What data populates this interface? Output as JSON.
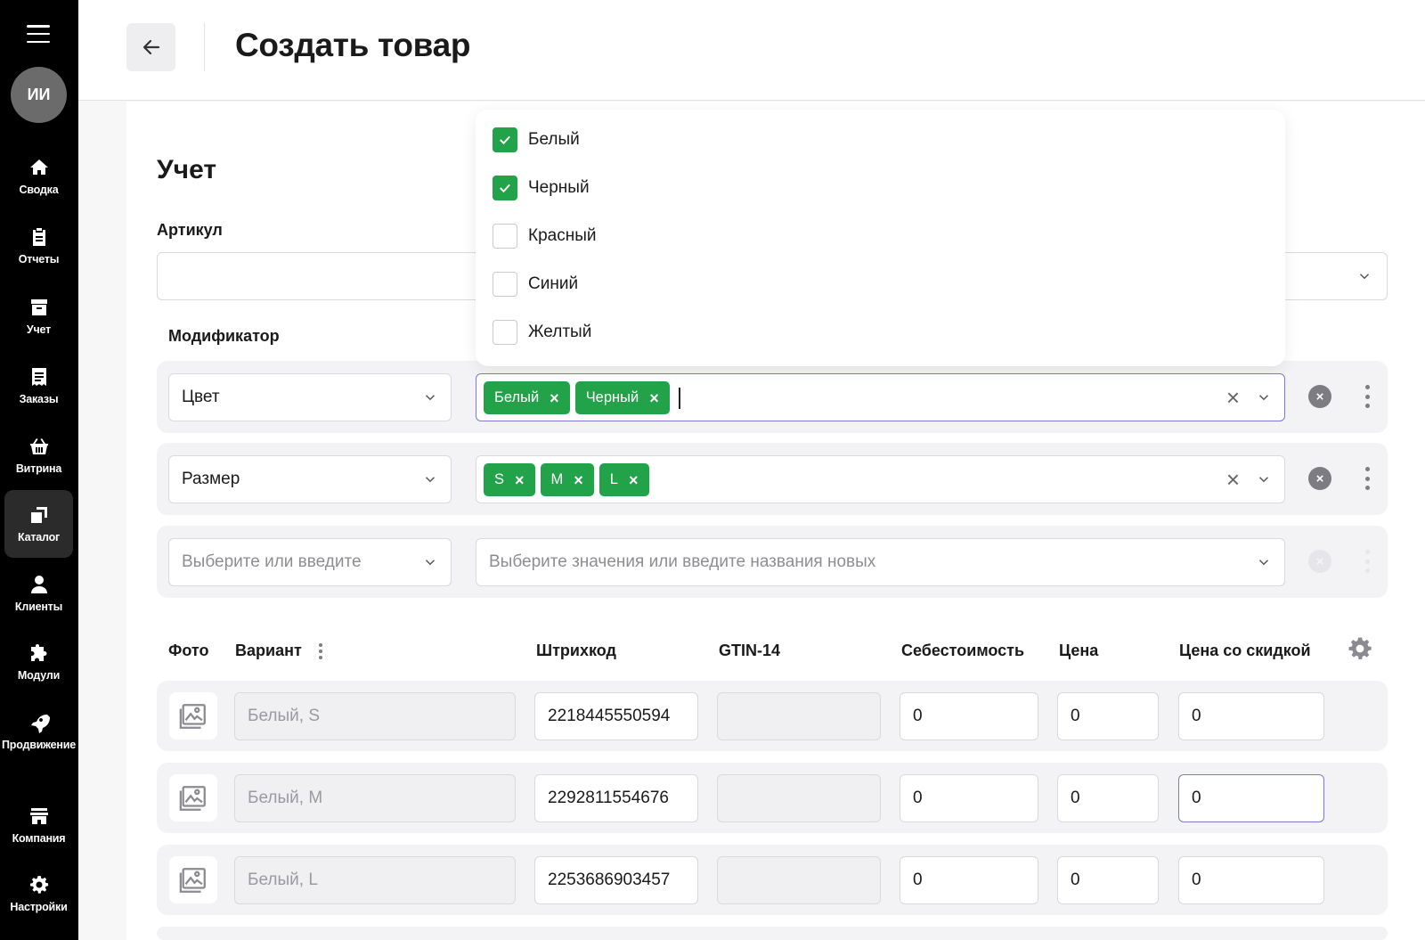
{
  "sidebar": {
    "avatar_initials": "ИИ",
    "items": [
      {
        "label": "Сводка",
        "icon": "home-icon"
      },
      {
        "label": "Отчеты",
        "icon": "clipboard-icon"
      },
      {
        "label": "Учет",
        "icon": "archive-icon"
      },
      {
        "label": "Заказы",
        "icon": "receipt-icon"
      },
      {
        "label": "Витрина",
        "icon": "basket-icon"
      },
      {
        "label": "Каталог",
        "icon": "catalog-icon",
        "active": true
      },
      {
        "label": "Клиенты",
        "icon": "user-icon"
      },
      {
        "label": "Модули",
        "icon": "puzzle-icon"
      },
      {
        "label": "Продвижение",
        "icon": "rocket-icon"
      },
      {
        "label": "Компания",
        "icon": "store-icon"
      },
      {
        "label": "Настройки",
        "icon": "gear-icon"
      }
    ]
  },
  "header": {
    "title": "Создать товар"
  },
  "section": {
    "title": "Учет",
    "sku_label": "Артикул",
    "sku_value": "",
    "modifier_label": "Модификатор"
  },
  "modifiers": [
    {
      "name": "Цвет",
      "tags": [
        "Белый",
        "Черный"
      ]
    },
    {
      "name": "Размер",
      "tags": [
        "S",
        "M",
        "L"
      ]
    },
    {
      "name_placeholder": "Выберите или введите",
      "values_placeholder": "Выберите значения или введите названия новых"
    }
  ],
  "dropdown": {
    "options": [
      {
        "label": "Белый",
        "checked": true
      },
      {
        "label": "Черный",
        "checked": true
      },
      {
        "label": "Красный",
        "checked": false
      },
      {
        "label": "Синий",
        "checked": false
      },
      {
        "label": "Желтый",
        "checked": false
      }
    ]
  },
  "table": {
    "headers": {
      "photo": "Фото",
      "variant": "Вариант",
      "barcode": "Штрихкод",
      "gtin": "GTIN-14",
      "cost": "Себестоимость",
      "price": "Цена",
      "sale_price": "Цена со скидкой"
    },
    "rows": [
      {
        "variant": "Белый, S",
        "barcode": "2218445550594",
        "gtin": "",
        "cost": "0",
        "price": "0",
        "sale_price": "0"
      },
      {
        "variant": "Белый, M",
        "barcode": "2292811554676",
        "gtin": "",
        "cost": "0",
        "price": "0",
        "sale_price": "0"
      },
      {
        "variant": "Белый, L",
        "barcode": "2253686903457",
        "gtin": "",
        "cost": "0",
        "price": "0",
        "sale_price": "0"
      }
    ]
  },
  "colors": {
    "accent_green": "#22a34a",
    "sidebar_bg": "#000000",
    "focus_border": "#7b7bd6"
  }
}
